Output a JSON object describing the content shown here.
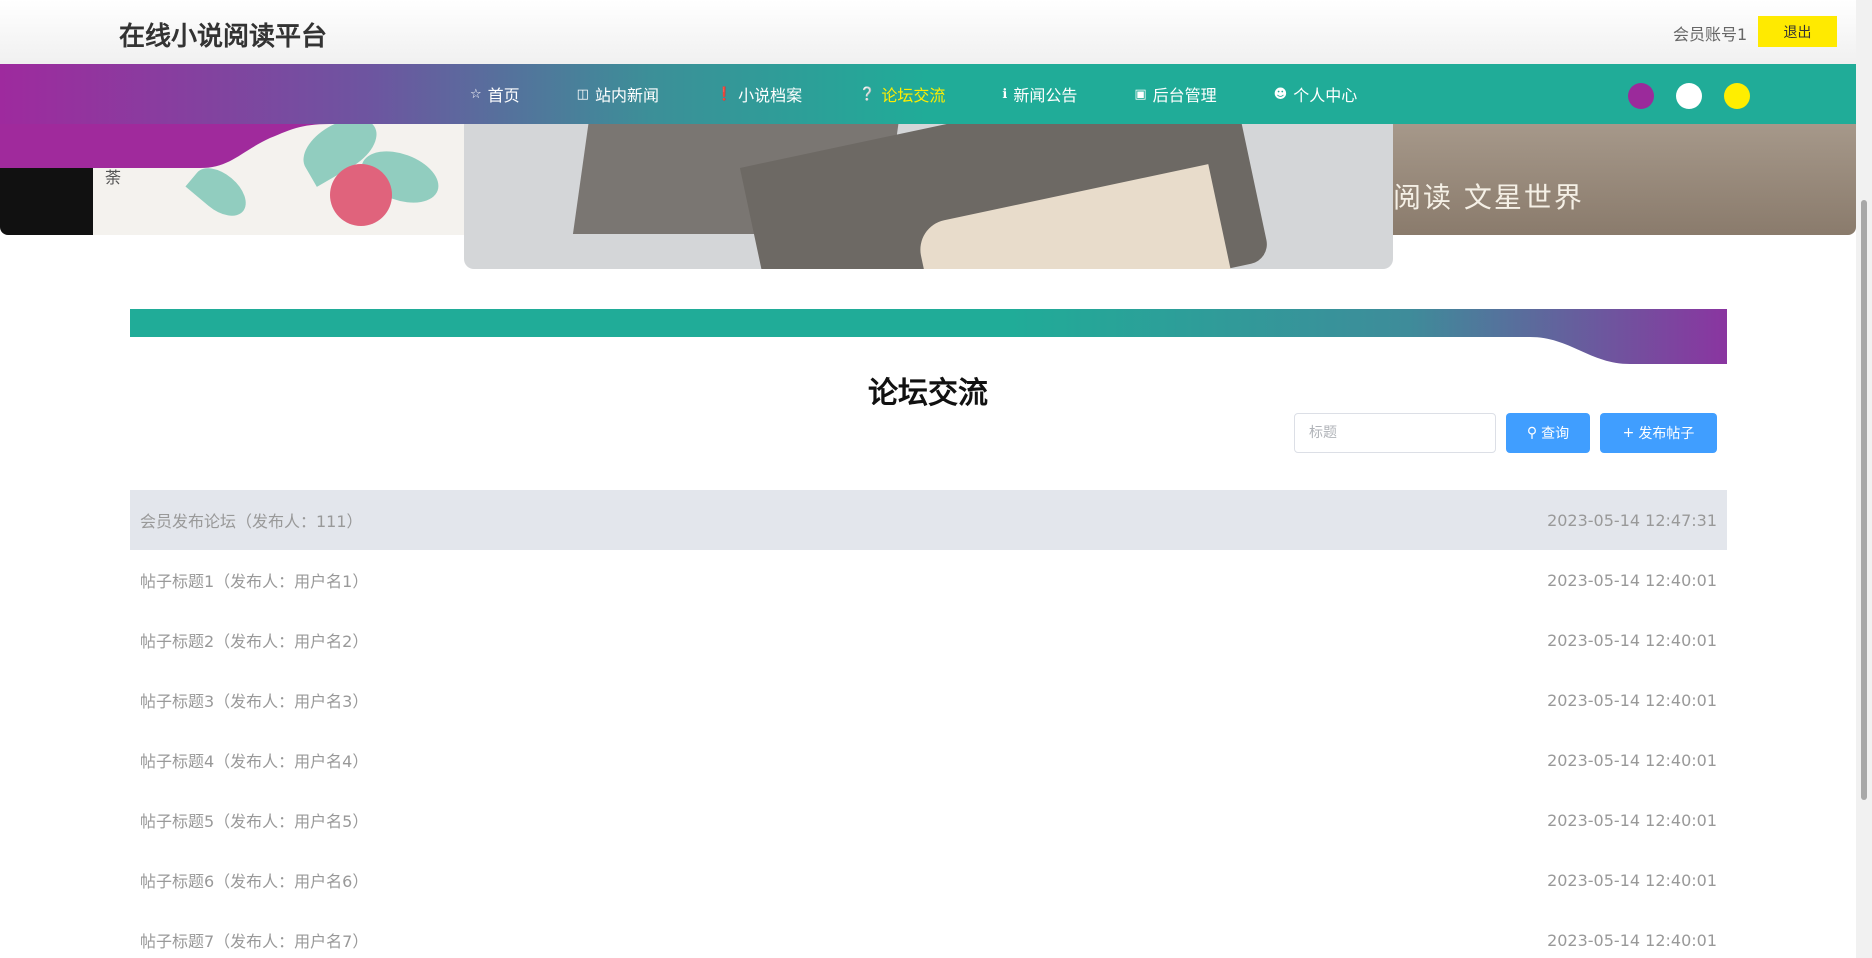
{
  "header": {
    "site_title": "在线小说阅读平台",
    "account": "会员账号1",
    "logout_label": "退出"
  },
  "banner": {
    "slide_left_chars": "荼",
    "slide_right_text": "阅读 文星世界",
    "dot_count": 3,
    "active_dot": 1
  },
  "nav": {
    "items": [
      {
        "label": "首页",
        "icon": "star-icon",
        "glyph": "☆"
      },
      {
        "label": "站内新闻",
        "icon": "bag-icon",
        "glyph": "🛍"
      },
      {
        "label": "小说档案",
        "icon": "info-icon",
        "glyph": "❗"
      },
      {
        "label": "论坛交流",
        "icon": "question-icon",
        "glyph": "?"
      },
      {
        "label": "新闻公告",
        "icon": "info-circle-icon",
        "glyph": "ℹ"
      },
      {
        "label": "后台管理",
        "icon": "briefcase-icon",
        "glyph": "▣"
      },
      {
        "label": "个人中心",
        "icon": "user-icon",
        "glyph": "👤"
      }
    ],
    "active_index": 3,
    "theme_colors": [
      "#9b2a9b",
      "#ffffff",
      "#ffee00"
    ]
  },
  "section": {
    "title": "论坛交流"
  },
  "search": {
    "placeholder": "标题",
    "query_label": "查询",
    "post_label": "发布帖子"
  },
  "posts": [
    {
      "title": "会员发布论坛（发布人：111）",
      "time": "2023-05-14 12:47:31"
    },
    {
      "title": "帖子标题1（发布人：用户名1）",
      "time": "2023-05-14 12:40:01"
    },
    {
      "title": "帖子标题2（发布人：用户名2）",
      "time": "2023-05-14 12:40:01"
    },
    {
      "title": "帖子标题3（发布人：用户名3）",
      "time": "2023-05-14 12:40:01"
    },
    {
      "title": "帖子标题4（发布人：用户名4）",
      "time": "2023-05-14 12:40:01"
    },
    {
      "title": "帖子标题5（发布人：用户名5）",
      "time": "2023-05-14 12:40:01"
    },
    {
      "title": "帖子标题6（发布人：用户名6）",
      "time": "2023-05-14 12:40:01"
    },
    {
      "title": "帖子标题7（发布人：用户名7）",
      "time": "2023-05-14 12:40:01"
    }
  ],
  "colors": {
    "accent": "#20ac98",
    "purple": "#9b2a9b",
    "button_blue": "#409eff",
    "logout_yellow": "#ffea00",
    "highlight_row": "#e3e6ec"
  }
}
